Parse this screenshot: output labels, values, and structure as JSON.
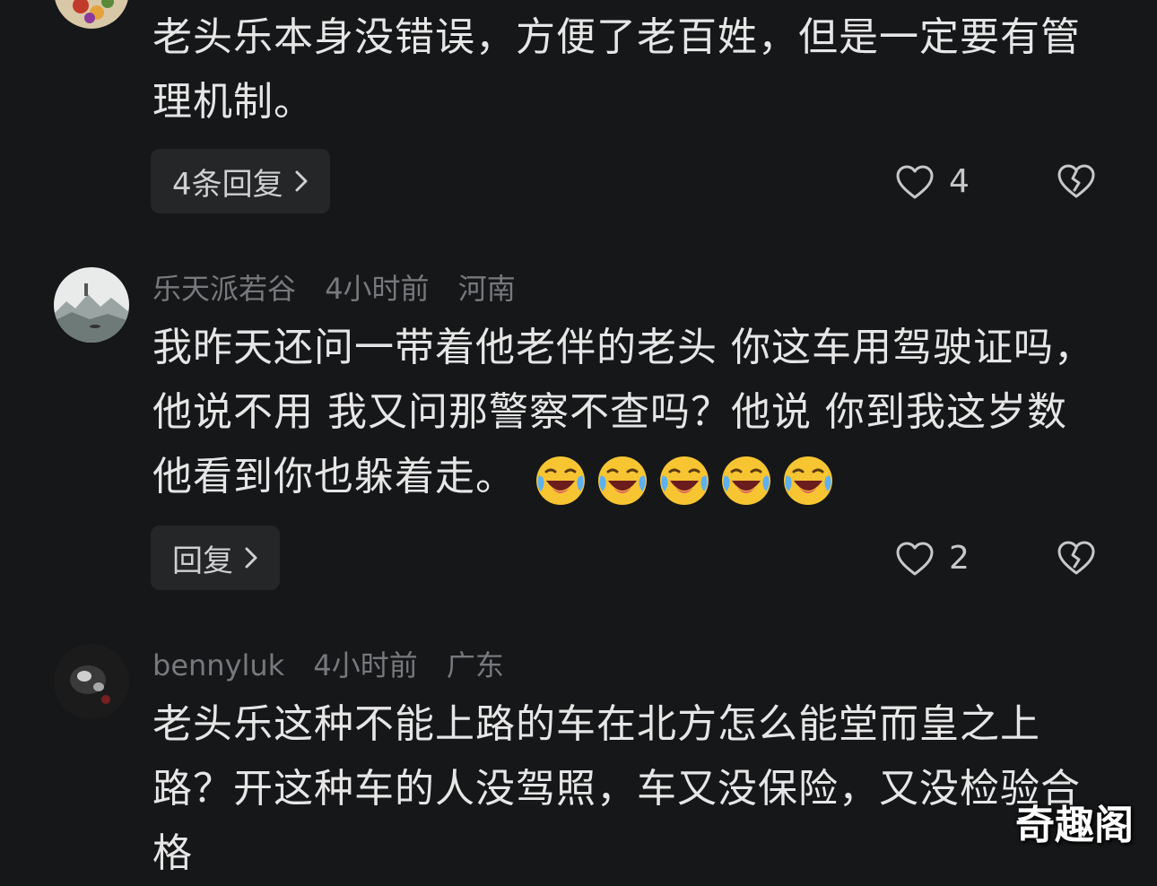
{
  "comments": [
    {
      "text": "老头乐本身没错误，方便了老百姓，但是一定要有管理机制。",
      "reply_label": "4条回复",
      "likes": "4"
    },
    {
      "username": "乐天派若谷",
      "time": "4小时前",
      "location": "河南",
      "text": "我昨天还问一带着他老伴的老头 你这车用驾驶证吗，他说不用 我又问那警察不查吗？他说 你到我这岁数 他看到你也躲着走。",
      "emoji_name": "loudly-crying-laughing-emoji",
      "emoji_count": 5,
      "reply_label": "回复",
      "likes": "2"
    },
    {
      "username": "bennyluk",
      "time": "4小时前",
      "location": "广东",
      "text": "老头乐这种不能上路的车在北方怎么能堂而皇之上路？开这种车的人没驾照，车又没保险，又没检验合格"
    }
  ],
  "watermark": "奇趣阁",
  "colors": {
    "background": "#161718",
    "meta": "#77797d",
    "text": "#e6e6e6",
    "button_bg": "#242628"
  }
}
